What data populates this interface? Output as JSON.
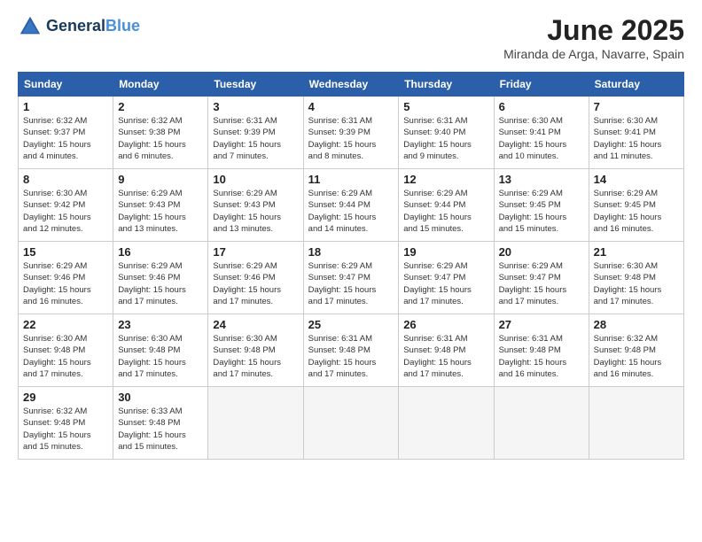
{
  "header": {
    "logo_line1": "General",
    "logo_line2": "Blue",
    "month_year": "June 2025",
    "location": "Miranda de Arga, Navarre, Spain"
  },
  "weekdays": [
    "Sunday",
    "Monday",
    "Tuesday",
    "Wednesday",
    "Thursday",
    "Friday",
    "Saturday"
  ],
  "weeks": [
    [
      {
        "day": "1",
        "detail": "Sunrise: 6:32 AM\nSunset: 9:37 PM\nDaylight: 15 hours\nand 4 minutes."
      },
      {
        "day": "2",
        "detail": "Sunrise: 6:32 AM\nSunset: 9:38 PM\nDaylight: 15 hours\nand 6 minutes."
      },
      {
        "day": "3",
        "detail": "Sunrise: 6:31 AM\nSunset: 9:39 PM\nDaylight: 15 hours\nand 7 minutes."
      },
      {
        "day": "4",
        "detail": "Sunrise: 6:31 AM\nSunset: 9:39 PM\nDaylight: 15 hours\nand 8 minutes."
      },
      {
        "day": "5",
        "detail": "Sunrise: 6:31 AM\nSunset: 9:40 PM\nDaylight: 15 hours\nand 9 minutes."
      },
      {
        "day": "6",
        "detail": "Sunrise: 6:30 AM\nSunset: 9:41 PM\nDaylight: 15 hours\nand 10 minutes."
      },
      {
        "day": "7",
        "detail": "Sunrise: 6:30 AM\nSunset: 9:41 PM\nDaylight: 15 hours\nand 11 minutes."
      }
    ],
    [
      {
        "day": "8",
        "detail": "Sunrise: 6:30 AM\nSunset: 9:42 PM\nDaylight: 15 hours\nand 12 minutes."
      },
      {
        "day": "9",
        "detail": "Sunrise: 6:29 AM\nSunset: 9:43 PM\nDaylight: 15 hours\nand 13 minutes."
      },
      {
        "day": "10",
        "detail": "Sunrise: 6:29 AM\nSunset: 9:43 PM\nDaylight: 15 hours\nand 13 minutes."
      },
      {
        "day": "11",
        "detail": "Sunrise: 6:29 AM\nSunset: 9:44 PM\nDaylight: 15 hours\nand 14 minutes."
      },
      {
        "day": "12",
        "detail": "Sunrise: 6:29 AM\nSunset: 9:44 PM\nDaylight: 15 hours\nand 15 minutes."
      },
      {
        "day": "13",
        "detail": "Sunrise: 6:29 AM\nSunset: 9:45 PM\nDaylight: 15 hours\nand 15 minutes."
      },
      {
        "day": "14",
        "detail": "Sunrise: 6:29 AM\nSunset: 9:45 PM\nDaylight: 15 hours\nand 16 minutes."
      }
    ],
    [
      {
        "day": "15",
        "detail": "Sunrise: 6:29 AM\nSunset: 9:46 PM\nDaylight: 15 hours\nand 16 minutes."
      },
      {
        "day": "16",
        "detail": "Sunrise: 6:29 AM\nSunset: 9:46 PM\nDaylight: 15 hours\nand 17 minutes."
      },
      {
        "day": "17",
        "detail": "Sunrise: 6:29 AM\nSunset: 9:46 PM\nDaylight: 15 hours\nand 17 minutes."
      },
      {
        "day": "18",
        "detail": "Sunrise: 6:29 AM\nSunset: 9:47 PM\nDaylight: 15 hours\nand 17 minutes."
      },
      {
        "day": "19",
        "detail": "Sunrise: 6:29 AM\nSunset: 9:47 PM\nDaylight: 15 hours\nand 17 minutes."
      },
      {
        "day": "20",
        "detail": "Sunrise: 6:29 AM\nSunset: 9:47 PM\nDaylight: 15 hours\nand 17 minutes."
      },
      {
        "day": "21",
        "detail": "Sunrise: 6:30 AM\nSunset: 9:48 PM\nDaylight: 15 hours\nand 17 minutes."
      }
    ],
    [
      {
        "day": "22",
        "detail": "Sunrise: 6:30 AM\nSunset: 9:48 PM\nDaylight: 15 hours\nand 17 minutes."
      },
      {
        "day": "23",
        "detail": "Sunrise: 6:30 AM\nSunset: 9:48 PM\nDaylight: 15 hours\nand 17 minutes."
      },
      {
        "day": "24",
        "detail": "Sunrise: 6:30 AM\nSunset: 9:48 PM\nDaylight: 15 hours\nand 17 minutes."
      },
      {
        "day": "25",
        "detail": "Sunrise: 6:31 AM\nSunset: 9:48 PM\nDaylight: 15 hours\nand 17 minutes."
      },
      {
        "day": "26",
        "detail": "Sunrise: 6:31 AM\nSunset: 9:48 PM\nDaylight: 15 hours\nand 17 minutes."
      },
      {
        "day": "27",
        "detail": "Sunrise: 6:31 AM\nSunset: 9:48 PM\nDaylight: 15 hours\nand 16 minutes."
      },
      {
        "day": "28",
        "detail": "Sunrise: 6:32 AM\nSunset: 9:48 PM\nDaylight: 15 hours\nand 16 minutes."
      }
    ],
    [
      {
        "day": "29",
        "detail": "Sunrise: 6:32 AM\nSunset: 9:48 PM\nDaylight: 15 hours\nand 15 minutes."
      },
      {
        "day": "30",
        "detail": "Sunrise: 6:33 AM\nSunset: 9:48 PM\nDaylight: 15 hours\nand 15 minutes."
      },
      {
        "day": "",
        "detail": ""
      },
      {
        "day": "",
        "detail": ""
      },
      {
        "day": "",
        "detail": ""
      },
      {
        "day": "",
        "detail": ""
      },
      {
        "day": "",
        "detail": ""
      }
    ]
  ]
}
